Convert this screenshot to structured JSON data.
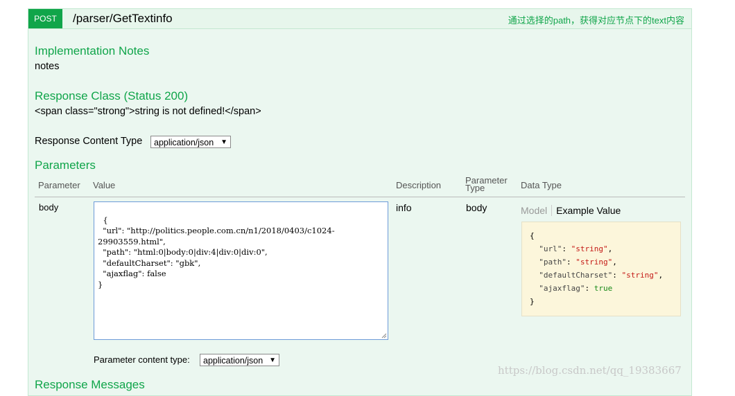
{
  "operation": {
    "method": "POST",
    "path": "/parser/GetTextinfo",
    "summary": "通过选择的path，获得对应节点下的text内容"
  },
  "implementation_notes": {
    "heading": "Implementation Notes",
    "text": "notes"
  },
  "response_class": {
    "heading": "Response Class (Status 200)",
    "text": "<span class=\"strong\">string is not defined!</span>"
  },
  "response_content_type": {
    "label": "Response Content Type",
    "selected": "application/json"
  },
  "parameters": {
    "heading": "Parameters",
    "columns": {
      "parameter": "Parameter",
      "value": "Value",
      "description": "Description",
      "parameter_type_line1": "Parameter",
      "parameter_type_line2": "Type",
      "data_type": "Data Type"
    },
    "row": {
      "name": "body",
      "value": "{\n  \"url\": \"http://politics.people.com.cn/n1/2018/0403/c1024-\n29903559.html\",\n  \"path\": \"html:0|body:0|div:4|div:0|div:0\",\n  \"defaultCharset\": \"gbk\",\n  \"ajaxflag\": false\n}",
      "description": "info",
      "param_type": "body",
      "model_tab": "Model",
      "example_tab": "Example Value",
      "example": {
        "open": "{",
        "url_key": "\"url\"",
        "url_val": "\"string\"",
        "path_key": "\"path\"",
        "path_val": "\"string\"",
        "charset_key": "\"defaultCharset\"",
        "charset_val": "\"string\"",
        "ajax_key": "\"ajaxflag\"",
        "ajax_val": "true",
        "close": "}"
      }
    },
    "content_type_label": "Parameter content type:",
    "content_type_selected": "application/json"
  },
  "response_messages": {
    "heading": "Response Messages"
  },
  "watermark": "https://blog.csdn.net/qq_19383667",
  "colors": {
    "accent": "#10a54a",
    "panel": "#ebf7f0",
    "example_bg": "#fcf6db"
  }
}
